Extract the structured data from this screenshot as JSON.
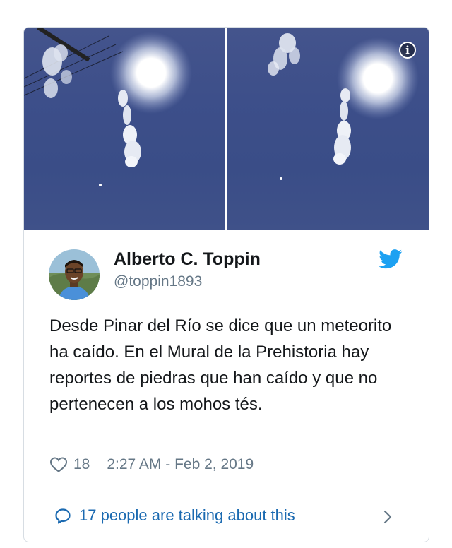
{
  "media": {
    "images": [
      {
        "name": "sky-photo-left",
        "icon": "sky-with-sun-and-smoke-trail"
      },
      {
        "name": "sky-photo-right",
        "icon": "sky-with-sun-and-smoke-trail"
      }
    ],
    "info_icon": "info-icon"
  },
  "author": {
    "name": "Alberto C. Toppin",
    "handle": "@toppin1893",
    "avatar_icon": "avatar"
  },
  "tweet": {
    "text": "Desde Pinar del Río se dice que un meteorito ha caído. En el Mural de la Prehistoria hay reportes de piedras que han caído y que no pertenecen a los mohos tés.",
    "likes": "18",
    "timestamp": "2:27 AM - Feb 2, 2019"
  },
  "footer": {
    "talking_label": "17 people are talking about this"
  },
  "colors": {
    "brand_blue": "#1da1f2",
    "link_blue": "#1b6ab1",
    "muted_gray": "#657786",
    "text": "#14171a"
  }
}
